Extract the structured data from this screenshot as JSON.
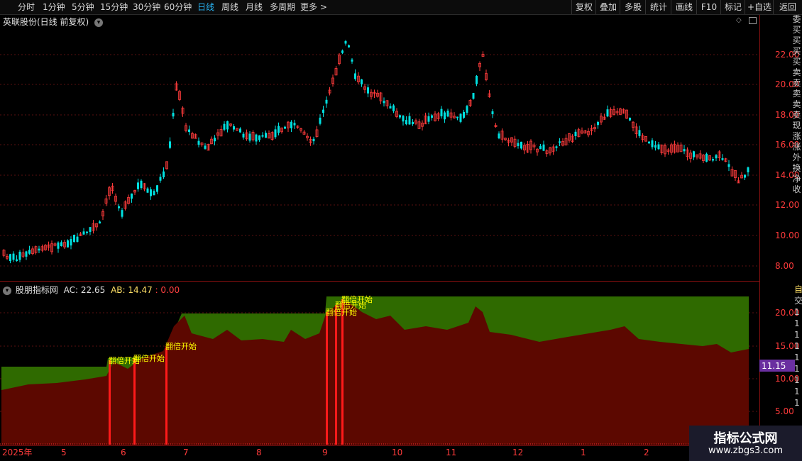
{
  "toolbar": {
    "periods": [
      "分时",
      "1分钟",
      "5分钟",
      "15分钟",
      "30分钟",
      "60分钟",
      "日线",
      "周线",
      "月线",
      "多周期",
      "更多 >"
    ],
    "active_period": "日线",
    "right_buttons": [
      "复权",
      "叠加",
      "多股",
      "统计",
      "画线",
      "F10",
      "标记",
      "+自选",
      "返回"
    ]
  },
  "main_chart": {
    "title": "英联股份(日线 前复权)",
    "price_labels": [
      "22.00",
      "20.00",
      "18.00",
      "16.00",
      "14.00",
      "12.00",
      "10.00",
      "8.00"
    ]
  },
  "indicator": {
    "name": "股朋指标网",
    "ac_label": "AC: 22.65",
    "ab_label": "AB: 14.47",
    "extra_label": ": 0.00",
    "signal_text": "翻倍开始",
    "value_labels": [
      "20.00",
      "15.00",
      "10.00",
      "5.00"
    ],
    "current_value": "11.15"
  },
  "date_axis": {
    "labels": [
      "2025年",
      "5",
      "6",
      "7",
      "8",
      "9",
      "10",
      "11",
      "12",
      "1",
      "2"
    ]
  },
  "right_strip": {
    "top_chars": [
      "委",
      "买",
      "买",
      "买",
      "买",
      "卖",
      "卖",
      "卖",
      "卖",
      "卖",
      "现",
      "涨",
      "涨",
      "外",
      "换",
      "净",
      "收"
    ],
    "bottom_chars": [
      "自",
      "交",
      "1",
      "1",
      "1",
      "1",
      "1",
      "1",
      "1",
      "1",
      "1"
    ]
  },
  "watermark": {
    "line1": "指标公式网",
    "line2": "www.zbgs3.com"
  },
  "colors": {
    "up": "#ff3b3b",
    "down": "#00e0e0",
    "green_fill": "#2f6a00",
    "red_fill": "#5c0800",
    "signal": "#ffff00",
    "active_tab": "#29b6f6",
    "value_badge": "#6a2fa0"
  }
}
